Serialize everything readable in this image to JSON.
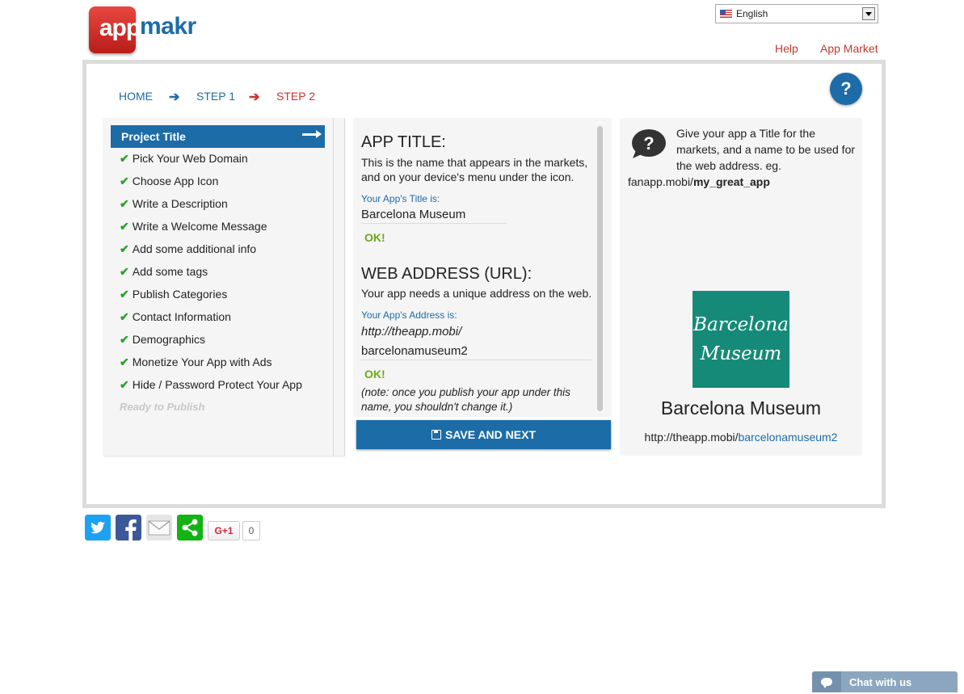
{
  "header": {
    "logo_app": "app",
    "logo_makr": "makr",
    "language": "English",
    "links": [
      "Help",
      "App Market"
    ]
  },
  "breadcrumb": {
    "home": "HOME",
    "step1": "STEP 1",
    "step2": "STEP 2"
  },
  "help_button": "?",
  "steps": {
    "active": "Project Title",
    "done": [
      "Pick Your Web Domain",
      "Choose App Icon",
      "Write a Description",
      "Write a Welcome Message",
      "Add some additional info",
      "Add some tags",
      "Publish Categories",
      "Contact Information",
      "Demographics",
      "Monetize Your App with Ads",
      "Hide / Password Protect Your App"
    ],
    "ready": "Ready to Publish"
  },
  "form": {
    "title_heading": "APP TITLE:",
    "title_desc": "This is the name that appears in the markets, and on your device's menu under the icon.",
    "title_label": "Your App's Title is:",
    "title_value": "Barcelona Museum",
    "title_status": "OK!",
    "url_heading": "WEB ADDRESS (URL):",
    "url_desc": "Your app needs a unique address on the web.",
    "url_label": "Your App's Address is:",
    "url_prefix": "http://theapp.mobi/",
    "url_value": "barcelonamuseum2",
    "url_status": "OK!",
    "note": "(note: once you publish your app under this name, you shouldn't change it.)",
    "save_label": "SAVE AND NEXT"
  },
  "info": {
    "tip": "Give your app a Title for the markets, and a name to be used for the web address. eg.",
    "example_prefix": "fanapp.mobi/",
    "example_slug": "my_great_app",
    "preview_line1": "Barcelona",
    "preview_line2": "Museum",
    "preview_title": "Barcelona Museum",
    "preview_url_prefix": "http://theapp.mobi/",
    "preview_url_slug": "barcelonamuseum2"
  },
  "social": {
    "gplus_label": "G+1",
    "gplus_count": "0"
  },
  "chat": {
    "label": "Chat with us"
  },
  "colors": {
    "primary": "#1c6ca8",
    "accent_red": "#d0312d",
    "ok_green": "#6aaa1a",
    "check_green": "#2aa02a",
    "thumb_bg": "#168a78"
  }
}
